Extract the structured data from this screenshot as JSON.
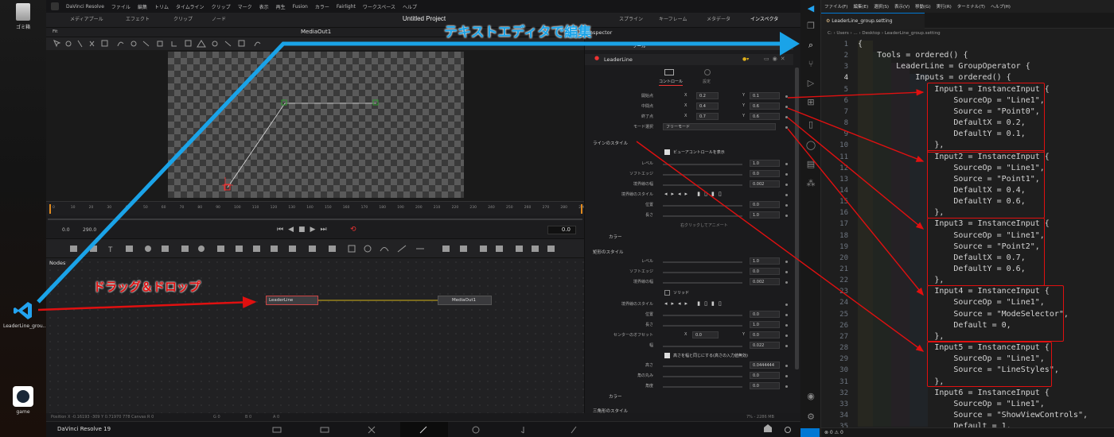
{
  "desktop": {
    "icons": [
      {
        "label": "ゴミ箱",
        "name": "recycle-bin"
      },
      {
        "label": "LeaderLine_grou...",
        "name": "vscode-file"
      },
      {
        "label": "game",
        "name": "steam"
      }
    ]
  },
  "resolve": {
    "menu": [
      "DaVinci Resolve",
      "ファイル",
      "編集",
      "トリム",
      "タイムライン",
      "クリップ",
      "マーク",
      "表示",
      "再生",
      "Fusion",
      "カラー",
      "Fairlight",
      "ワークスペース",
      "ヘルプ"
    ],
    "toolbar": {
      "media_pool": "メディアプール",
      "effects": "エフェクト",
      "clips": "クリップ",
      "nodes": "ノード",
      "project_title": "Untitled Project",
      "spline": "スプライン",
      "keyframes": "キーフレーム",
      "metadata": "メタデータ",
      "inspector": "インスペクタ"
    },
    "viewer": {
      "title": "MediaOut1",
      "fit": "Fit"
    },
    "ruler_ticks": [
      "0",
      "5",
      "10",
      "15",
      "20",
      "25",
      "30",
      "35",
      "40",
      "45",
      "50",
      "55",
      "60",
      "65",
      "70",
      "75",
      "80",
      "85",
      "90",
      "95",
      "100",
      "105",
      "110",
      "115",
      "120",
      "125",
      "130",
      "135",
      "140",
      "145",
      "150",
      "155",
      "160",
      "165",
      "170",
      "175",
      "180",
      "185",
      "190",
      "195",
      "200",
      "205",
      "210",
      "215",
      "220",
      "225",
      "230",
      "235",
      "240",
      "245",
      "250",
      "255",
      "260",
      "265",
      "270",
      "275",
      "280",
      "285",
      "290"
    ],
    "transport": {
      "start": "0.0",
      "end": "290.0",
      "current": "0.0"
    },
    "nodes": {
      "title": "Nodes",
      "leader": "LeaderLine",
      "mediaout": "MediaOut1"
    },
    "status": {
      "position": "Position  X -0.16193  -309   Y 0.71970   778   Canvas  R 0",
      "g": "G 0",
      "b": "B 0",
      "a": "A 0",
      "memory": "7% - 2286 MB"
    },
    "brand": "DaVinci Resolve 19"
  },
  "inspector": {
    "title": "Inspector",
    "tab": "ツール",
    "tool_name": "LeaderLine",
    "sub_tabs": [
      "コントロール",
      "設定"
    ],
    "points": [
      {
        "label": "開始点",
        "x": "0.2",
        "y": "0.1"
      },
      {
        "label": "中間点",
        "x": "0.4",
        "y": "0.6"
      },
      {
        "label": "終了点",
        "x": "0.7",
        "y": "0.6"
      }
    ],
    "mode_label": "モード選択",
    "mode_value": "フリーモード",
    "line_style_header": "ラインのスタイル",
    "show_view_controls": "ビューアコントロールを表示",
    "line_rows": [
      {
        "label": "レベル",
        "value": "1.0"
      },
      {
        "label": "ソフトエッジ",
        "value": "0.0"
      },
      {
        "label": "境界線の幅",
        "value": "0.002"
      },
      {
        "label": "境界線のスタイル",
        "value": ""
      },
      {
        "label": "位置",
        "value": "0.0"
      },
      {
        "label": "長さ",
        "value": "1.0"
      }
    ],
    "anim_hint": "右クリックしてアニメート",
    "color_label": "カラー",
    "rect_header": "矩形のスタイル",
    "rect_rows": [
      {
        "label": "レベル",
        "value": "1.0"
      },
      {
        "label": "ソフトエッジ",
        "value": "0.0"
      },
      {
        "label": "境界線の幅",
        "value": "0.002"
      }
    ],
    "solid": "ソリッド",
    "rect_rows2": [
      {
        "label": "境界線のスタイル",
        "value": ""
      },
      {
        "label": "位置",
        "value": "0.0"
      },
      {
        "label": "長さ",
        "value": "1.0"
      }
    ],
    "center_offset": {
      "label": "センターのオフセット",
      "x": "0.0",
      "y": "0.0"
    },
    "width": {
      "label": "幅",
      "value": "0.022"
    },
    "height_link": "高さを幅と同じにする(高さの入力値無効)",
    "rect_rows3": [
      {
        "label": "高さ",
        "value": "0.0444444"
      },
      {
        "label": "角の丸み",
        "value": "0.0"
      },
      {
        "label": "角度",
        "value": "0.0"
      }
    ],
    "color_label2": "カラー",
    "triangle_header": "三角形のスタイル"
  },
  "vscode": {
    "menu": [
      "ファイル(F)",
      "編集(E)",
      "選択(S)",
      "表示(V)",
      "移動(G)",
      "実行(R)",
      "ターミナル(T)",
      "ヘルプ(H)"
    ],
    "tab": "LeaderLine_group.setting",
    "breadcrumb": "C: › Users › ... › Desktop › LeaderLine_group.setting",
    "lines": [
      "{",
      "    Tools = ordered() {",
      "        LeaderLine = GroupOperator {",
      "            Inputs = ordered() {",
      "                Input1 = InstanceInput {",
      "                    SourceOp = \"Line1\",",
      "                    Source = \"Point0\",",
      "                    DefaultX = 0.2,",
      "                    DefaultY = 0.1,",
      "                },",
      "                Input2 = InstanceInput {",
      "                    SourceOp = \"Line1\",",
      "                    Source = \"Point1\",",
      "                    DefaultX = 0.4,",
      "                    DefaultY = 0.6,",
      "                },",
      "                Input3 = InstanceInput {",
      "                    SourceOp = \"Line1\",",
      "                    Source = \"Point2\",",
      "                    DefaultX = 0.7,",
      "                    DefaultY = 0.6,",
      "                },",
      "                Input4 = InstanceInput {",
      "                    SourceOp = \"Line1\",",
      "                    Source = \"ModeSelector\",",
      "                    Default = 0,",
      "                },",
      "                Input5 = InstanceInput {",
      "                    SourceOp = \"Line1\",",
      "                    Source = \"LineStyles\",",
      "                },",
      "                Input6 = InstanceInput {",
      "                    SourceOp = \"Line1\",",
      "                    Source = \"ShowViewControls\",",
      "                    Default = 1,"
    ],
    "status": "⊗ 0 ⚠ 0"
  },
  "annotations": {
    "text_editor": "テキストエディタで編集",
    "drag_drop": "ドラッグ＆ドロップ",
    "blue": "#1aa3e8",
    "red": "#e01010"
  }
}
